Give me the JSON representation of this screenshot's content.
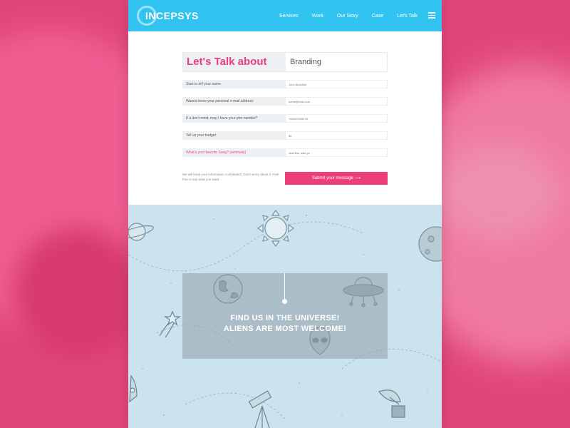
{
  "brand": {
    "name": "INCEPSYS"
  },
  "nav": {
    "items": [
      "Services",
      "Work",
      "Our Story",
      "Case",
      "Let's Talk"
    ]
  },
  "form": {
    "heading": "Let's Talk about",
    "topic": "Branding",
    "rows": [
      {
        "label": "Start to tell your name",
        "placeholder": "John Abdullah"
      },
      {
        "label": "Wanna know your personal e-mail address",
        "placeholder": "name@mail.com"
      },
      {
        "label": "If u don't mind, may I have your phn number?",
        "placeholder": "+62812345678"
      },
      {
        "label": "Tell us your budget",
        "placeholder": "$0"
      },
      {
        "label": "What's your favorite Song? (seriously)",
        "placeholder": "Just fine, said yo"
      }
    ],
    "disclaimer": "We will keep your information confidential. Don't worry about it. Feel free to say what you want.",
    "submit": "Submit your message ⟶"
  },
  "space": {
    "line1": "FIND US IN THE UNIVERSE!",
    "line2": "ALIENS ARE MOST WELCOME!"
  },
  "colors": {
    "navbar": "#32c4f0",
    "accent": "#ec3e7b",
    "space_bg": "#cbe3ee",
    "backdrop": "#e1467a"
  },
  "icons": [
    "hamburger-menu-icon",
    "saturn-icon",
    "sun-icon",
    "moon-icon",
    "earth-icon",
    "ufo-icon",
    "alien-icon",
    "shooting-star-icon",
    "telescope-icon",
    "satellite-dish-icon",
    "rocket-icon"
  ]
}
